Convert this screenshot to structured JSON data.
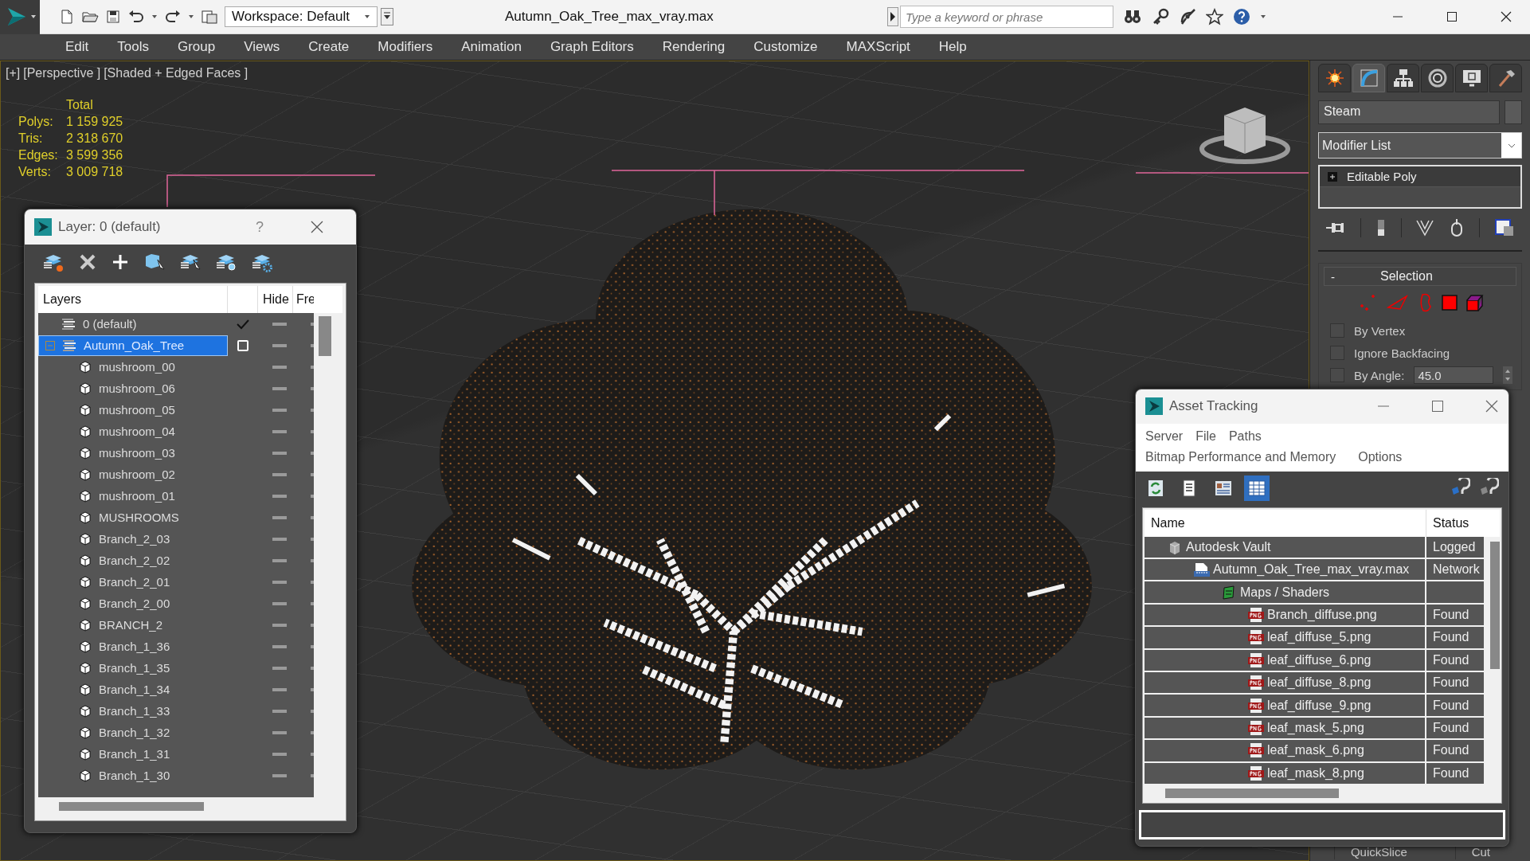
{
  "window": {
    "title": "Autumn_Oak_Tree_max_vray.max"
  },
  "toolbar": {
    "workspace": "Workspace: Default"
  },
  "search": {
    "placeholder": "Type a keyword or phrase"
  },
  "menu": [
    "Edit",
    "Tools",
    "Group",
    "Views",
    "Create",
    "Modifiers",
    "Animation",
    "Graph Editors",
    "Rendering",
    "Customize",
    "MAXScript",
    "Help"
  ],
  "viewport": {
    "labels": [
      "[+]",
      "[Perspective ]",
      "[Shaded + Edged Faces ]"
    ],
    "stats": {
      "heading": "Total",
      "rows": [
        {
          "label": "Polys:",
          "value": "1 159 925"
        },
        {
          "label": "Tris:",
          "value": "2 318 670"
        },
        {
          "label": "Edges:",
          "value": "3 599 356"
        },
        {
          "label": "Verts:",
          "value": "3 009 718"
        }
      ]
    }
  },
  "layer_window": {
    "title": "Layer: 0 (default)",
    "help": "?",
    "columns": [
      "Layers",
      "Hide",
      "Fre"
    ],
    "layers": [
      {
        "name": "0 (default)",
        "current": true,
        "selected": false
      },
      {
        "name": "Autumn_Oak_Tree",
        "current": false,
        "selected": true,
        "expanded": true,
        "children": [
          {
            "name": "mushroom_00",
            "selected": false
          },
          {
            "name": "mushroom_06",
            "selected": false
          },
          {
            "name": "mushroom_05",
            "selected": false
          },
          {
            "name": "mushroom_04",
            "selected": false
          },
          {
            "name": "mushroom_03",
            "selected": false
          },
          {
            "name": "mushroom_02",
            "selected": false
          },
          {
            "name": "mushroom_01",
            "selected": false
          },
          {
            "name": "MUSHROOMS",
            "selected": false
          },
          {
            "name": "Branch_2_03",
            "selected": false
          },
          {
            "name": "Branch_2_02",
            "selected": false
          },
          {
            "name": "Branch_2_01",
            "selected": false
          },
          {
            "name": "Branch_2_00",
            "selected": false
          },
          {
            "name": "BRANCH_2",
            "selected": false
          },
          {
            "name": "Branch_1_36",
            "selected": false
          },
          {
            "name": "Branch_1_35",
            "selected": false
          },
          {
            "name": "Branch_1_34",
            "selected": false
          },
          {
            "name": "Branch_1_33",
            "selected": false
          },
          {
            "name": "Branch_1_32",
            "selected": false
          },
          {
            "name": "Branch_1_31",
            "selected": false
          },
          {
            "name": "Branch_1_30",
            "selected": false
          }
        ]
      }
    ]
  },
  "command_panel": {
    "tabs": [
      {
        "kind": "create",
        "selected": false
      },
      {
        "kind": "modify",
        "selected": true
      },
      {
        "kind": "hierarchy",
        "selected": false
      },
      {
        "kind": "motion",
        "selected": false
      },
      {
        "kind": "display",
        "selected": false
      },
      {
        "kind": "utilities",
        "selected": false
      }
    ],
    "object_name": "Steam",
    "modifier_list": "Modifier List",
    "stack": [
      "Editable Poly"
    ],
    "selection": {
      "collapse": "-",
      "title": "Selection",
      "options": [
        {
          "label": "By Vertex",
          "checked": false
        },
        {
          "label": "Ignore Backfacing",
          "checked": false
        },
        {
          "label": "By Angle:",
          "checked": false,
          "value": "45.0"
        }
      ]
    },
    "buttons": [
      "QuickSlice",
      "Cut"
    ]
  },
  "asset_window": {
    "title": "Asset Tracking",
    "menu": [
      "Server",
      "File",
      "Paths",
      "Bitmap Performance and Memory",
      "Options"
    ],
    "views": [
      {
        "kind": "refresh",
        "selected": false
      },
      {
        "kind": "list",
        "selected": false
      },
      {
        "kind": "thumbnails",
        "selected": false
      },
      {
        "kind": "table",
        "selected": true
      }
    ],
    "columns": [
      "Name",
      "Status"
    ],
    "rows": [
      {
        "kind": "vault",
        "name": "Autodesk Vault",
        "status": "Logged",
        "children": [
          {
            "kind": "max",
            "name": "Autumn_Oak_Tree_max_vray.max",
            "status": "Network",
            "children": [
              {
                "kind": "folder",
                "name": "Maps / Shaders",
                "children": [
                  {
                    "kind": "png",
                    "name": "Branch_diffuse.png",
                    "status": "Found"
                  },
                  {
                    "kind": "png",
                    "name": "leaf_diffuse_5.png",
                    "status": "Found"
                  },
                  {
                    "kind": "png",
                    "name": "leaf_diffuse_6.png",
                    "status": "Found"
                  },
                  {
                    "kind": "png",
                    "name": "leaf_diffuse_8.png",
                    "status": "Found"
                  },
                  {
                    "kind": "png",
                    "name": "leaf_diffuse_9.png",
                    "status": "Found"
                  },
                  {
                    "kind": "png",
                    "name": "leaf_mask_5.png",
                    "status": "Found"
                  },
                  {
                    "kind": "png",
                    "name": "leaf_mask_6.png",
                    "status": "Found"
                  },
                  {
                    "kind": "png",
                    "name": "leaf_mask_8.png",
                    "status": "Found"
                  }
                ]
              }
            ]
          }
        ]
      }
    ]
  }
}
